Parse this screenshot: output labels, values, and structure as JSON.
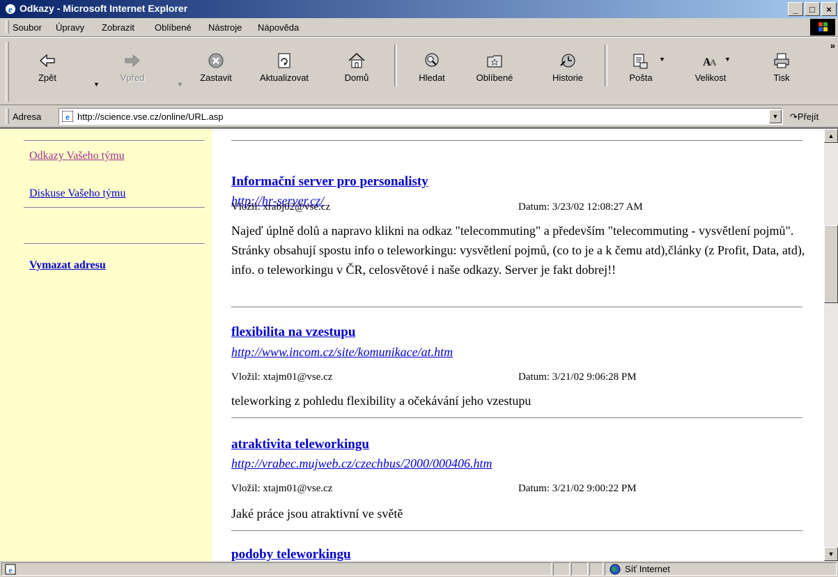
{
  "window": {
    "title": "Odkazy - Microsoft Internet Explorer",
    "minimize": "_",
    "maximize": "□",
    "close": "×"
  },
  "menu": [
    "Soubor",
    "Úpravy",
    "Zobrazit",
    "Oblíbené",
    "Nástroje",
    "Nápověda"
  ],
  "toolbar": {
    "back": "Zpět",
    "forward": "Vpřed",
    "stop": "Zastavit",
    "refresh": "Aktualizovat",
    "home": "Domů",
    "search": "Hledat",
    "favorites": "Oblíbené",
    "history": "Historie",
    "mail": "Pošta",
    "size": "Velikost",
    "print": "Tisk",
    "more": "»"
  },
  "address": {
    "label": "Adresa",
    "url": "http://science.vse.cz/online/URL.asp",
    "go": "Přejít"
  },
  "sidebar": {
    "links": [
      "Odkazy Vašeho týmu",
      "Diskuse Vašeho týmu"
    ],
    "clear": "Vymazat adresu"
  },
  "items": [
    {
      "title": "Informační server pro personalisty",
      "url": "http://hr-server.cz/",
      "author": "Vložil: xrabj02@vse.cz",
      "date": "Datum: 3/23/02 12:08:27 AM",
      "desc": "Najeď úplně dolů a napravo klikni na odkaz \"telecommuting\" a především \"telecommuting - vysvětlení pojmů\". Stránky obsahují spostu info o teleworkingu: vysvětlení pojmů, (co to je a k čemu atd),články (z Profit, Data, atd), info. o teleworkingu v ČR, celosvětové i naše odkazy. Server je fakt dobrej!!"
    },
    {
      "title": "flexibilita na vzestupu",
      "url": "http://www.incom.cz/site/komunikace/at.htm",
      "author": "Vložil: xtajm01@vse.cz",
      "date": "Datum: 3/21/02 9:06:28 PM",
      "desc": "teleworking z pohledu flexibility a očekávání jeho vzestupu"
    },
    {
      "title": "atraktivita teleworkingu",
      "url": "http://vrabec.mujweb.cz/czechbus/2000/000406.htm",
      "author": "Vložil: xtajm01@vse.cz",
      "date": "Datum: 3/21/02 9:00:22 PM",
      "desc": "Jaké práce jsou atraktivní ve světě"
    },
    {
      "title": "podoby teleworkingu"
    }
  ],
  "status": {
    "zone": "Síť Internet"
  }
}
